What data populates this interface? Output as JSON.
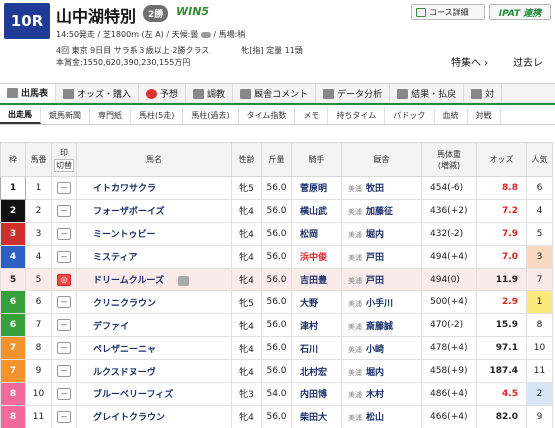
{
  "race": {
    "number": "10R",
    "title": "山中湖特別",
    "grade": "2勝",
    "win5": "WIN5",
    "info1": "14:50発走 / 芝1800m (左 A) / 天候:曇 ",
    "info1b": " / 馬場:稍",
    "info2": "4回 東京 9日目 サラ系３歳以上 2勝クラス　　　　牝[指] 定量 11頭",
    "info3": "本賞金:1550,620,390,230,155万円"
  },
  "header_buttons": {
    "course": "コース詳細",
    "ipat": "IPAT 連携"
  },
  "links": {
    "feature": "特集へ ›",
    "past": "过去レ"
  },
  "menu": [
    {
      "label": "出馬表",
      "icon": "table-icon"
    },
    {
      "label": "オッズ・購入",
      "icon": "odds-icon"
    },
    {
      "label": "予想",
      "icon": "target-icon"
    },
    {
      "label": "調教",
      "icon": "clock-icon"
    },
    {
      "label": "厩舎コメント",
      "icon": "stable-icon"
    },
    {
      "label": "データ分析",
      "icon": "chart-icon"
    },
    {
      "label": "結果・払戻",
      "icon": "result-icon"
    },
    {
      "label": "対",
      "icon": "more-icon"
    }
  ],
  "subtabs": [
    "出走馬",
    "競馬新聞",
    "専門紙",
    "馬柱(5走)",
    "馬柱(過去)",
    "タイム指数",
    "メモ",
    "持ちタイム",
    "パドック",
    "血統",
    "対戦"
  ],
  "columns": {
    "waku": "枠",
    "num": "馬番",
    "mark": "印",
    "mark2": "切替",
    "name": "馬名",
    "sex": "性齢",
    "kinryo": "斤量",
    "jockey": "騎手",
    "stable": "厩舎",
    "weight": "馬体重",
    "weight2": "(増減)",
    "odds": "オッズ",
    "pop": "人気"
  },
  "horses": [
    {
      "waku": "1",
      "num": "1",
      "mark": "--",
      "name": "イトカワサクラ",
      "sex": "牝5",
      "kinryo": "56.0",
      "jockey": "菅原明",
      "region": "美浦",
      "trainer": "牧田",
      "weight": "454(-6)",
      "odds": "8.8",
      "pop": "6"
    },
    {
      "waku": "2",
      "num": "2",
      "mark": "--",
      "name": "フォーザボーイズ",
      "sex": "牝4",
      "kinryo": "56.0",
      "jockey": "横山武",
      "region": "美浦",
      "trainer": "加藤征",
      "weight": "436(+2)",
      "odds": "7.2",
      "pop": "4"
    },
    {
      "waku": "3",
      "num": "3",
      "mark": "--",
      "name": "ミーントゥビー",
      "sex": "牝4",
      "kinryo": "56.0",
      "jockey": "松岡",
      "region": "美浦",
      "trainer": "堀内",
      "weight": "432(-2)",
      "odds": "7.9",
      "pop": "5"
    },
    {
      "waku": "4",
      "num": "4",
      "mark": "--",
      "name": "ミスティア",
      "sex": "牝4",
      "kinryo": "56.0",
      "jockey": "浜中俊",
      "region": "美浦",
      "trainer": "戸田",
      "weight": "494(+4)",
      "odds": "7.0",
      "pop": "3"
    },
    {
      "waku": "5",
      "num": "5",
      "mark": "◎",
      "name": "ドリームクルーズ",
      "sex": "牝4",
      "kinryo": "56.0",
      "jockey": "吉田豊",
      "region": "美浦",
      "trainer": "戸田",
      "weight": "494(0)",
      "odds": "11.9",
      "pop": "7"
    },
    {
      "waku": "6",
      "num": "6",
      "mark": "--",
      "name": "クリニクラウン",
      "sex": "牝5",
      "kinryo": "56.0",
      "jockey": "大野",
      "region": "美浦",
      "trainer": "小手川",
      "weight": "500(+4)",
      "odds": "2.9",
      "pop": "1"
    },
    {
      "waku": "6",
      "num": "7",
      "mark": "--",
      "name": "デファイ",
      "sex": "牝4",
      "kinryo": "56.0",
      "jockey": "津村",
      "region": "美浦",
      "trainer": "斎藤誠",
      "weight": "470(-2)",
      "odds": "15.9",
      "pop": "8"
    },
    {
      "waku": "7",
      "num": "8",
      "mark": "--",
      "name": "ペレザニーニャ",
      "sex": "牝4",
      "kinryo": "56.0",
      "jockey": "石川",
      "region": "美浦",
      "trainer": "小崎",
      "weight": "478(+4)",
      "odds": "97.1",
      "pop": "10"
    },
    {
      "waku": "7",
      "num": "9",
      "mark": "--",
      "name": "ルクスドヌーヴ",
      "sex": "牝4",
      "kinryo": "56.0",
      "jockey": "北村宏",
      "region": "美浦",
      "trainer": "堀内",
      "weight": "458(+9)",
      "odds": "187.4",
      "pop": "11"
    },
    {
      "waku": "8",
      "num": "10",
      "mark": "--",
      "name": "ブルーベリーフィズ",
      "sex": "牝3",
      "kinryo": "54.0",
      "jockey": "内田博",
      "region": "美浦",
      "trainer": "木村",
      "weight": "486(+4)",
      "odds": "4.5",
      "pop": "2"
    },
    {
      "waku": "8",
      "num": "11",
      "mark": "--",
      "name": "グレイトクラウン",
      "sex": "牝4",
      "kinryo": "56.0",
      "jockey": "柴田大",
      "region": "美浦",
      "trainer": "松山",
      "weight": "466(+4)",
      "odds": "82.0",
      "pop": "9"
    }
  ],
  "colors": {
    "badge": "#1f3b96",
    "accent_green": "#2a8a3a",
    "odds_red": "#d22",
    "highlight_row": "#fbeaea"
  }
}
